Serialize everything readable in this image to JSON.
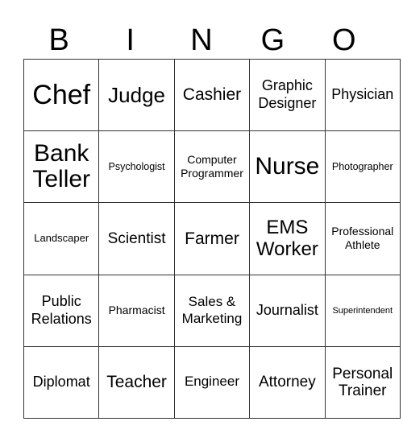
{
  "header": {
    "letters": [
      "B",
      "I",
      "N",
      "G",
      "O"
    ]
  },
  "cells": [
    [
      "Chef",
      "Judge",
      "Cashier",
      "Graphic Designer",
      "Physician"
    ],
    [
      "Bank Teller",
      "Psychologist",
      "Computer Programmer",
      "Nurse",
      "Photographer"
    ],
    [
      "Landscaper",
      "Scientist",
      "Farmer",
      "EMS Worker",
      "Professional Athlete"
    ],
    [
      "Public Relations",
      "Pharmacist",
      "Sales & Marketing",
      "Journalist",
      "Superintendent"
    ],
    [
      "Diplomat",
      "Teacher",
      "Engineer",
      "Attorney",
      "Personal Trainer"
    ]
  ]
}
